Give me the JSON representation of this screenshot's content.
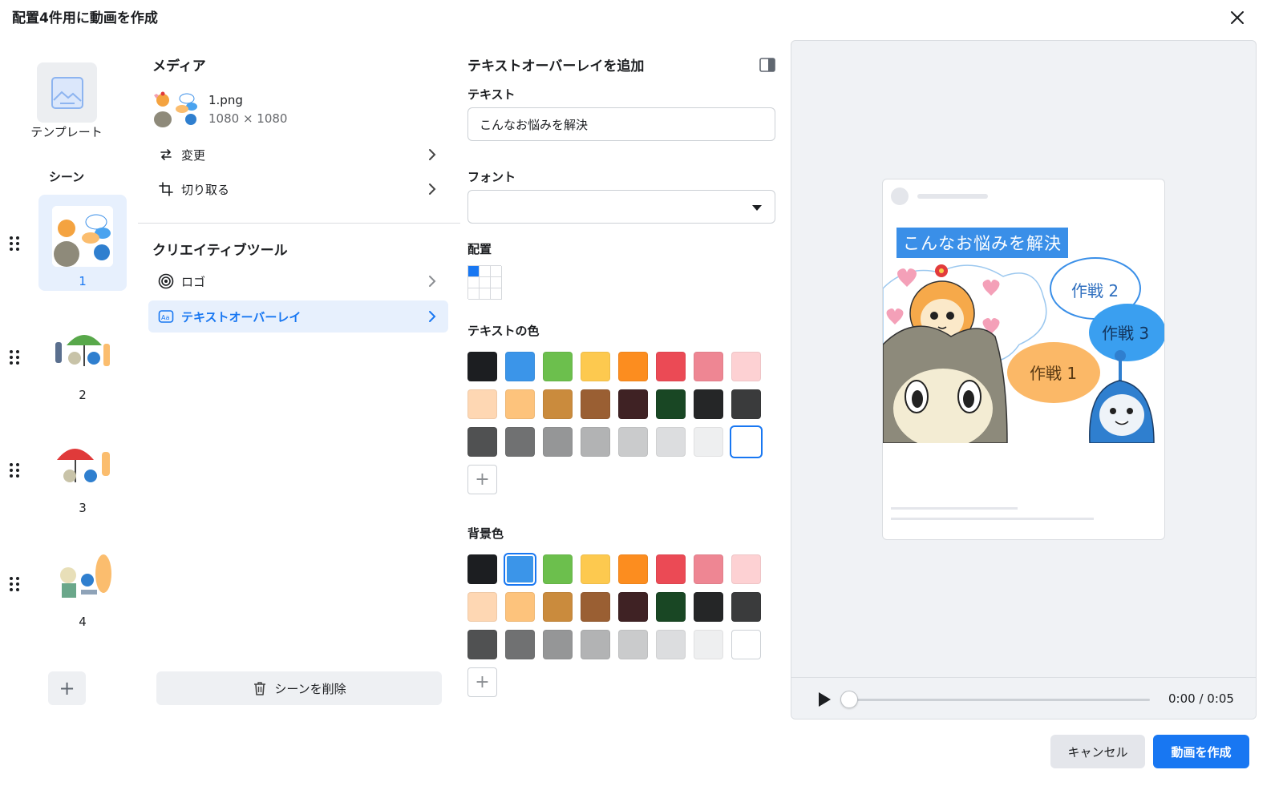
{
  "dialog": {
    "title": "配置4件用に動画を作成"
  },
  "scenes_panel": {
    "template_label": "テンプレート",
    "scenes_heading": "シーン",
    "scenes": [
      {
        "number": "1",
        "selected": true
      },
      {
        "number": "2",
        "selected": false
      },
      {
        "number": "3",
        "selected": false
      },
      {
        "number": "4",
        "selected": false
      }
    ],
    "add_scene_symbol": "+"
  },
  "media_panel": {
    "heading": "メディア",
    "file_name": "1.png",
    "file_dimensions": "1080 × 1080",
    "actions": [
      {
        "label": "変更",
        "icon": "swap-arrows-icon"
      },
      {
        "label": "切り取る",
        "icon": "crop-icon"
      }
    ],
    "creative_tools_heading": "クリエイティブツール",
    "tools": [
      {
        "label": "ロゴ",
        "icon": "logo-target-icon",
        "active": false
      },
      {
        "label": "テキストオーバーレイ",
        "icon": "text-overlay-icon",
        "active": true
      }
    ],
    "delete_scene_label": "シーンを削除"
  },
  "overlay_panel": {
    "heading": "テキストオーバーレイを追加",
    "text_label": "テキスト",
    "text_value": "こんなお悩みを解決",
    "font_label": "フォント",
    "font_value": "",
    "position_label": "配置",
    "position_selected": "top-left",
    "text_color_label": "テキストの色",
    "bg_color_label": "背景色",
    "palette": [
      "#1c1e21",
      "#3b95e9",
      "#6cbf4d",
      "#fdc94f",
      "#fc8d1f",
      "#eb4a55",
      "#ee8693",
      "#fdd1d3",
      "#fed7b3",
      "#fdc37c",
      "#ca8b3d",
      "#9a5f33",
      "#3f2224",
      "#194724",
      "#252627",
      "#3a3b3c",
      "#505152",
      "#707172",
      "#959697",
      "#b2b3b4",
      "#cacbcc",
      "#dcdddf",
      "#eeeff0",
      "#ffffff"
    ],
    "text_color_selected_index": 23,
    "bg_color_selected_index": 1,
    "add_color_symbol": "+"
  },
  "preview": {
    "overlay_text": "こんなお悩みを解決",
    "time": "0:00 / 0:05",
    "progress": 0
  },
  "footer": {
    "cancel_label": "キャンセル",
    "create_label": "動画を作成"
  },
  "colors": {
    "accent": "#1877f2",
    "selected_bg": "#e7f0fd"
  }
}
